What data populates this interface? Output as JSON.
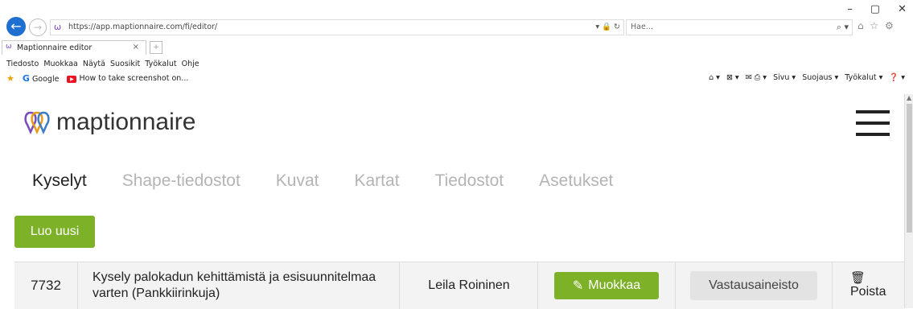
{
  "window_controls": {
    "minimize": "–",
    "maximize": "▢",
    "close": "✕"
  },
  "browser": {
    "url": "https://app.maptionnaire.com/fi/editor/",
    "address_tools": "▾ 🔒 ↻",
    "search_placeholder": "Hae...",
    "search_icon": "⌕ ▾",
    "toolbar_icons": "⌂ ☆ ⚙",
    "tab_title": "Maptionnaire editor",
    "tab_close": "×",
    "menu": [
      "Tiedosto",
      "Muokkaa",
      "Näytä",
      "Suosikit",
      "Työkalut",
      "Ohje"
    ],
    "favorites": [
      {
        "icon": "G",
        "label": "Google"
      },
      {
        "icon": "▶",
        "label": "How to take screenshot on..."
      }
    ],
    "command_bar": [
      "⌂ ▾",
      "⊠ ▾",
      "✉ ⎙ ▾",
      "Sivu ▾",
      "Suojaus ▾",
      "Työkalut ▾",
      "❓ ▾"
    ]
  },
  "app": {
    "logo_text": "maptionnaire",
    "nav": [
      {
        "label": "Kyselyt",
        "active": true
      },
      {
        "label": "Shape-tiedostot",
        "active": false
      },
      {
        "label": "Kuvat",
        "active": false
      },
      {
        "label": "Kartat",
        "active": false
      },
      {
        "label": "Tiedostot",
        "active": false
      },
      {
        "label": "Asetukset",
        "active": false
      }
    ],
    "create_button": "Luo uusi",
    "rows": [
      {
        "id": "7732",
        "title": "Kysely palokadun kehittämistä ja esisuunnitelmaa varten (Pankkiirinkuja)",
        "owner": "Leila Roininen",
        "edit_label": "Muokkaa",
        "responses_label": "Vastausaineisto",
        "delete_label": "Poista"
      }
    ]
  },
  "colors": {
    "accent_green": "#7db128",
    "nav_inactive": "#b4b4b4",
    "row_bg": "#f3f3f3",
    "logo_purple": "#7a4bbf"
  }
}
